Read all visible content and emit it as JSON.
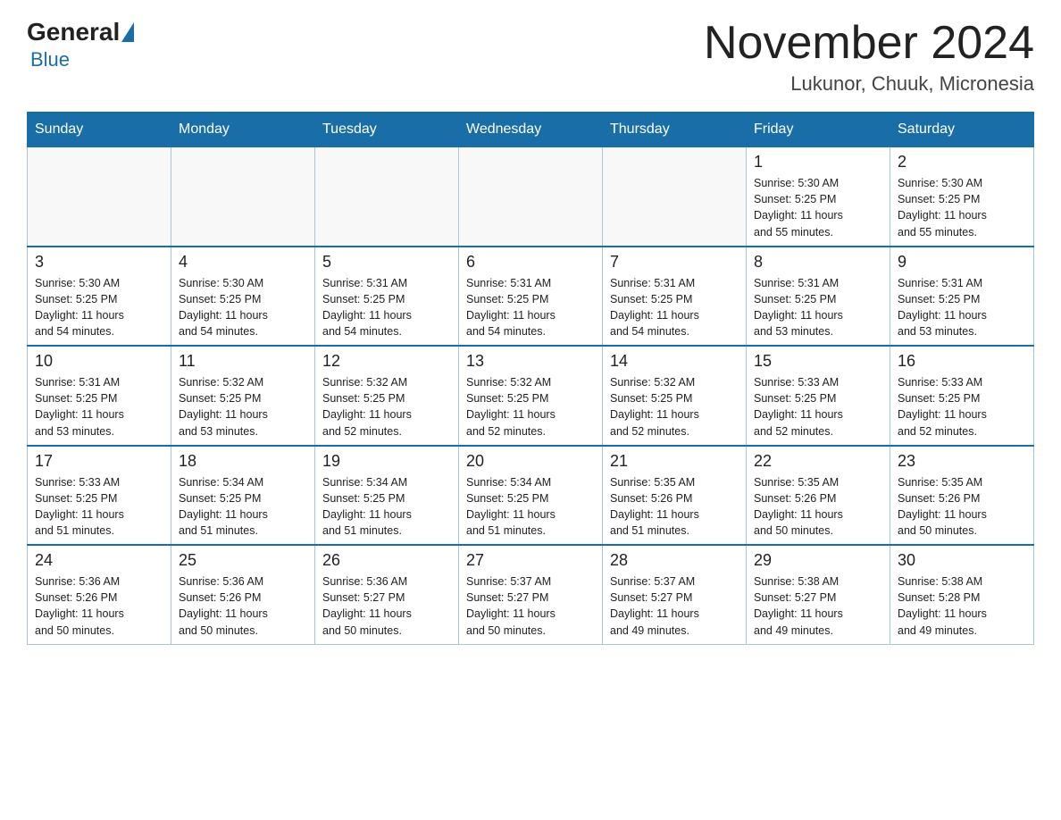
{
  "header": {
    "logo_general": "General",
    "logo_blue": "Blue",
    "month_title": "November 2024",
    "location": "Lukunor, Chuuk, Micronesia"
  },
  "weekdays": [
    "Sunday",
    "Monday",
    "Tuesday",
    "Wednesday",
    "Thursday",
    "Friday",
    "Saturday"
  ],
  "weeks": [
    [
      {
        "day": "",
        "info": ""
      },
      {
        "day": "",
        "info": ""
      },
      {
        "day": "",
        "info": ""
      },
      {
        "day": "",
        "info": ""
      },
      {
        "day": "",
        "info": ""
      },
      {
        "day": "1",
        "info": "Sunrise: 5:30 AM\nSunset: 5:25 PM\nDaylight: 11 hours\nand 55 minutes."
      },
      {
        "day": "2",
        "info": "Sunrise: 5:30 AM\nSunset: 5:25 PM\nDaylight: 11 hours\nand 55 minutes."
      }
    ],
    [
      {
        "day": "3",
        "info": "Sunrise: 5:30 AM\nSunset: 5:25 PM\nDaylight: 11 hours\nand 54 minutes."
      },
      {
        "day": "4",
        "info": "Sunrise: 5:30 AM\nSunset: 5:25 PM\nDaylight: 11 hours\nand 54 minutes."
      },
      {
        "day": "5",
        "info": "Sunrise: 5:31 AM\nSunset: 5:25 PM\nDaylight: 11 hours\nand 54 minutes."
      },
      {
        "day": "6",
        "info": "Sunrise: 5:31 AM\nSunset: 5:25 PM\nDaylight: 11 hours\nand 54 minutes."
      },
      {
        "day": "7",
        "info": "Sunrise: 5:31 AM\nSunset: 5:25 PM\nDaylight: 11 hours\nand 54 minutes."
      },
      {
        "day": "8",
        "info": "Sunrise: 5:31 AM\nSunset: 5:25 PM\nDaylight: 11 hours\nand 53 minutes."
      },
      {
        "day": "9",
        "info": "Sunrise: 5:31 AM\nSunset: 5:25 PM\nDaylight: 11 hours\nand 53 minutes."
      }
    ],
    [
      {
        "day": "10",
        "info": "Sunrise: 5:31 AM\nSunset: 5:25 PM\nDaylight: 11 hours\nand 53 minutes."
      },
      {
        "day": "11",
        "info": "Sunrise: 5:32 AM\nSunset: 5:25 PM\nDaylight: 11 hours\nand 53 minutes."
      },
      {
        "day": "12",
        "info": "Sunrise: 5:32 AM\nSunset: 5:25 PM\nDaylight: 11 hours\nand 52 minutes."
      },
      {
        "day": "13",
        "info": "Sunrise: 5:32 AM\nSunset: 5:25 PM\nDaylight: 11 hours\nand 52 minutes."
      },
      {
        "day": "14",
        "info": "Sunrise: 5:32 AM\nSunset: 5:25 PM\nDaylight: 11 hours\nand 52 minutes."
      },
      {
        "day": "15",
        "info": "Sunrise: 5:33 AM\nSunset: 5:25 PM\nDaylight: 11 hours\nand 52 minutes."
      },
      {
        "day": "16",
        "info": "Sunrise: 5:33 AM\nSunset: 5:25 PM\nDaylight: 11 hours\nand 52 minutes."
      }
    ],
    [
      {
        "day": "17",
        "info": "Sunrise: 5:33 AM\nSunset: 5:25 PM\nDaylight: 11 hours\nand 51 minutes."
      },
      {
        "day": "18",
        "info": "Sunrise: 5:34 AM\nSunset: 5:25 PM\nDaylight: 11 hours\nand 51 minutes."
      },
      {
        "day": "19",
        "info": "Sunrise: 5:34 AM\nSunset: 5:25 PM\nDaylight: 11 hours\nand 51 minutes."
      },
      {
        "day": "20",
        "info": "Sunrise: 5:34 AM\nSunset: 5:25 PM\nDaylight: 11 hours\nand 51 minutes."
      },
      {
        "day": "21",
        "info": "Sunrise: 5:35 AM\nSunset: 5:26 PM\nDaylight: 11 hours\nand 51 minutes."
      },
      {
        "day": "22",
        "info": "Sunrise: 5:35 AM\nSunset: 5:26 PM\nDaylight: 11 hours\nand 50 minutes."
      },
      {
        "day": "23",
        "info": "Sunrise: 5:35 AM\nSunset: 5:26 PM\nDaylight: 11 hours\nand 50 minutes."
      }
    ],
    [
      {
        "day": "24",
        "info": "Sunrise: 5:36 AM\nSunset: 5:26 PM\nDaylight: 11 hours\nand 50 minutes."
      },
      {
        "day": "25",
        "info": "Sunrise: 5:36 AM\nSunset: 5:26 PM\nDaylight: 11 hours\nand 50 minutes."
      },
      {
        "day": "26",
        "info": "Sunrise: 5:36 AM\nSunset: 5:27 PM\nDaylight: 11 hours\nand 50 minutes."
      },
      {
        "day": "27",
        "info": "Sunrise: 5:37 AM\nSunset: 5:27 PM\nDaylight: 11 hours\nand 50 minutes."
      },
      {
        "day": "28",
        "info": "Sunrise: 5:37 AM\nSunset: 5:27 PM\nDaylight: 11 hours\nand 49 minutes."
      },
      {
        "day": "29",
        "info": "Sunrise: 5:38 AM\nSunset: 5:27 PM\nDaylight: 11 hours\nand 49 minutes."
      },
      {
        "day": "30",
        "info": "Sunrise: 5:38 AM\nSunset: 5:28 PM\nDaylight: 11 hours\nand 49 minutes."
      }
    ]
  ]
}
